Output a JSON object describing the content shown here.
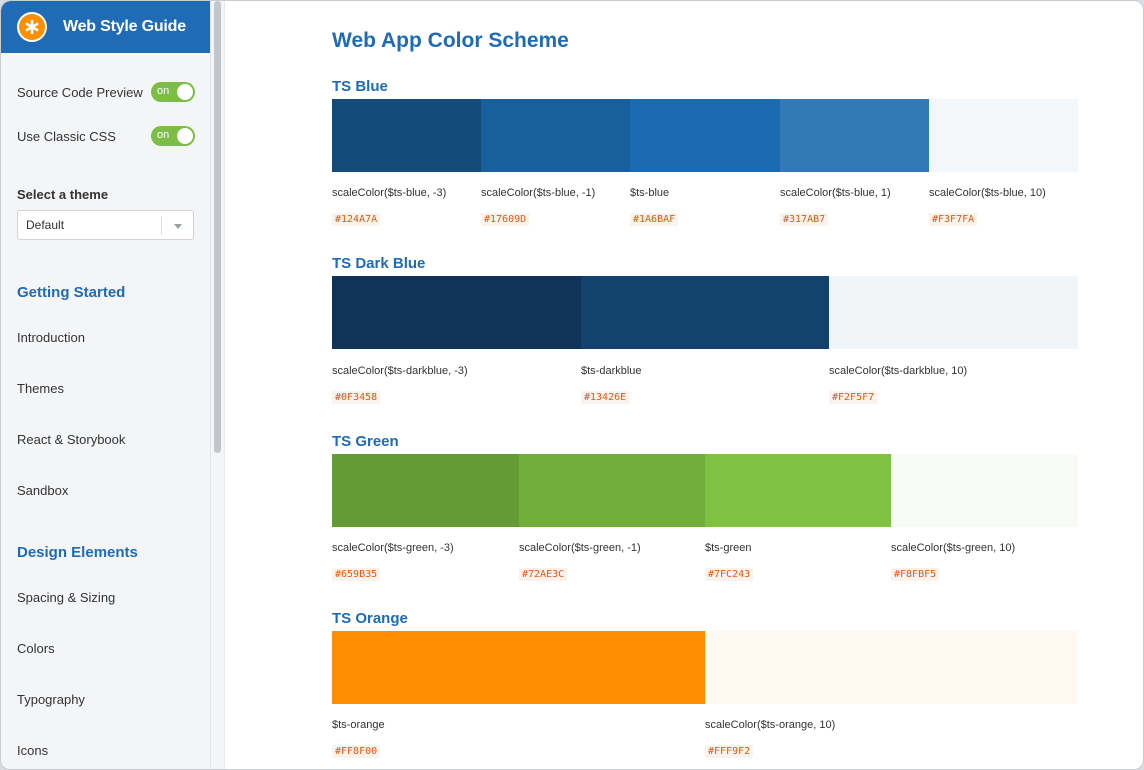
{
  "brand": {
    "title": "Web Style Guide",
    "logo_icon": "asterisk-icon"
  },
  "sidebar": {
    "toggles": [
      {
        "label": "Source Code Preview",
        "state": "on"
      },
      {
        "label": "Use Classic CSS",
        "state": "on"
      }
    ],
    "theme_label": "Select a theme",
    "theme_selected": "Default",
    "sections": [
      {
        "heading": "Getting Started",
        "items": [
          "Introduction",
          "Themes",
          "React & Storybook",
          "Sandbox"
        ]
      },
      {
        "heading": "Design Elements",
        "items": [
          "Spacing & Sizing",
          "Colors",
          "Typography",
          "Icons"
        ]
      }
    ]
  },
  "main": {
    "title": "Web App Color Scheme",
    "groups": [
      {
        "title": "TS Blue",
        "swatches": [
          {
            "name": "scaleColor($ts-blue, -3)",
            "hex": "#124A7A"
          },
          {
            "name": "scaleColor($ts-blue, -1)",
            "hex": "#17609D"
          },
          {
            "name": "$ts-blue",
            "hex": "#1A6BAF"
          },
          {
            "name": "scaleColor($ts-blue, 1)",
            "hex": "#317AB7"
          },
          {
            "name": "scaleColor($ts-blue, 10)",
            "hex": "#F3F7FA"
          }
        ]
      },
      {
        "title": "TS Dark Blue",
        "swatches": [
          {
            "name": "scaleColor($ts-darkblue, -3)",
            "hex": "#0F3458"
          },
          {
            "name": "$ts-darkblue",
            "hex": "#13426E"
          },
          {
            "name": "scaleColor($ts-darkblue, 10)",
            "hex": "#F2F5F7"
          }
        ]
      },
      {
        "title": "TS Green",
        "swatches": [
          {
            "name": "scaleColor($ts-green, -3)",
            "hex": "#659B35"
          },
          {
            "name": "scaleColor($ts-green, -1)",
            "hex": "#72AE3C"
          },
          {
            "name": "$ts-green",
            "hex": "#7FC243"
          },
          {
            "name": "scaleColor($ts-green, 10)",
            "hex": "#F8FBF5"
          }
        ]
      },
      {
        "title": "TS Orange",
        "swatches": [
          {
            "name": "$ts-orange",
            "hex": "#FF8F00"
          },
          {
            "name": "scaleColor($ts-orange, 10)",
            "hex": "#FFF9F2"
          }
        ]
      }
    ]
  }
}
